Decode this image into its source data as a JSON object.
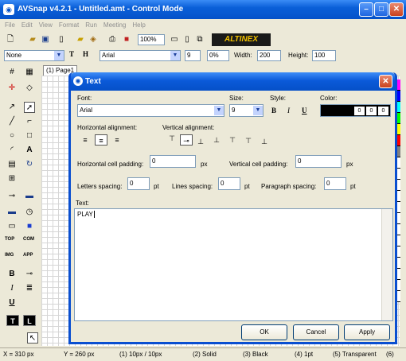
{
  "window": {
    "title": "AVSnap v4.2.1 - Untitled.amt - Control Mode"
  },
  "menu": [
    "File",
    "Edit",
    "View",
    "Format",
    "Run",
    "Meeting",
    "Help"
  ],
  "toolbar": {
    "zoom": "100%",
    "brand": "ALTINEX"
  },
  "format_bar": {
    "line_style": "None",
    "t_label": "T",
    "h_label": "H",
    "font": "Arial",
    "size": "9",
    "percent": "0%",
    "width_label": "Width:",
    "width_value": "200",
    "height_label": "Height:",
    "height_value": "100"
  },
  "left_tools": {
    "top_label": "TOP",
    "com_label": "COM",
    "img_label": "IMG",
    "app_label": "APP",
    "t_btn": "T",
    "l_btn": "L"
  },
  "page_tab": "(1) Page1",
  "palette": [
    "#ff00ff",
    "#0000ff",
    "#00ffff",
    "#00ff00",
    "#ffff00",
    "#ff0000",
    "#808080",
    "#ffffff",
    "#ffffff",
    "#ffffff",
    "#ffffff",
    "#ffffff",
    "#ffffff",
    "#ffffff",
    "#ffffff",
    "#ffffff",
    "#ffffff",
    "#ffffff",
    "#ffffff",
    "#ffffff"
  ],
  "status": {
    "x": "X = 310 px",
    "y": "Y = 260 px",
    "size": "(1) 10px / 10px",
    "line": "(2) Solid",
    "color": "(3) Black",
    "width": "(4) 1pt",
    "fill": "(5) Transparent",
    "extra": "(6)"
  },
  "dialog": {
    "title": "Text",
    "font_label": "Font:",
    "font_value": "Arial",
    "size_label": "Size:",
    "size_value": "9",
    "style_label": "Style:",
    "bold": "B",
    "italic": "I",
    "underline": "U",
    "color_label": "Color:",
    "color_r": "0",
    "color_g": "0",
    "color_b": "0",
    "h_align_label": "Horizontal alignment:",
    "v_align_label": "Vertical alignment:",
    "h_pad_label": "Horizontal cell padding:",
    "h_pad_value": "0",
    "h_pad_unit": "px",
    "v_pad_label": "Vertical cell padding:",
    "v_pad_value": "0",
    "v_pad_unit": "px",
    "letters_label": "Letters spacing:",
    "letters_value": "0",
    "letters_unit": "pt",
    "lines_label": "Lines spacing:",
    "lines_value": "0",
    "lines_unit": "pt",
    "para_label": "Paragraph spacing:",
    "para_value": "0",
    "para_unit": "pt",
    "text_label": "Text:",
    "text_value": "PLAY",
    "ok": "OK",
    "cancel": "Cancel",
    "apply": "Apply"
  }
}
